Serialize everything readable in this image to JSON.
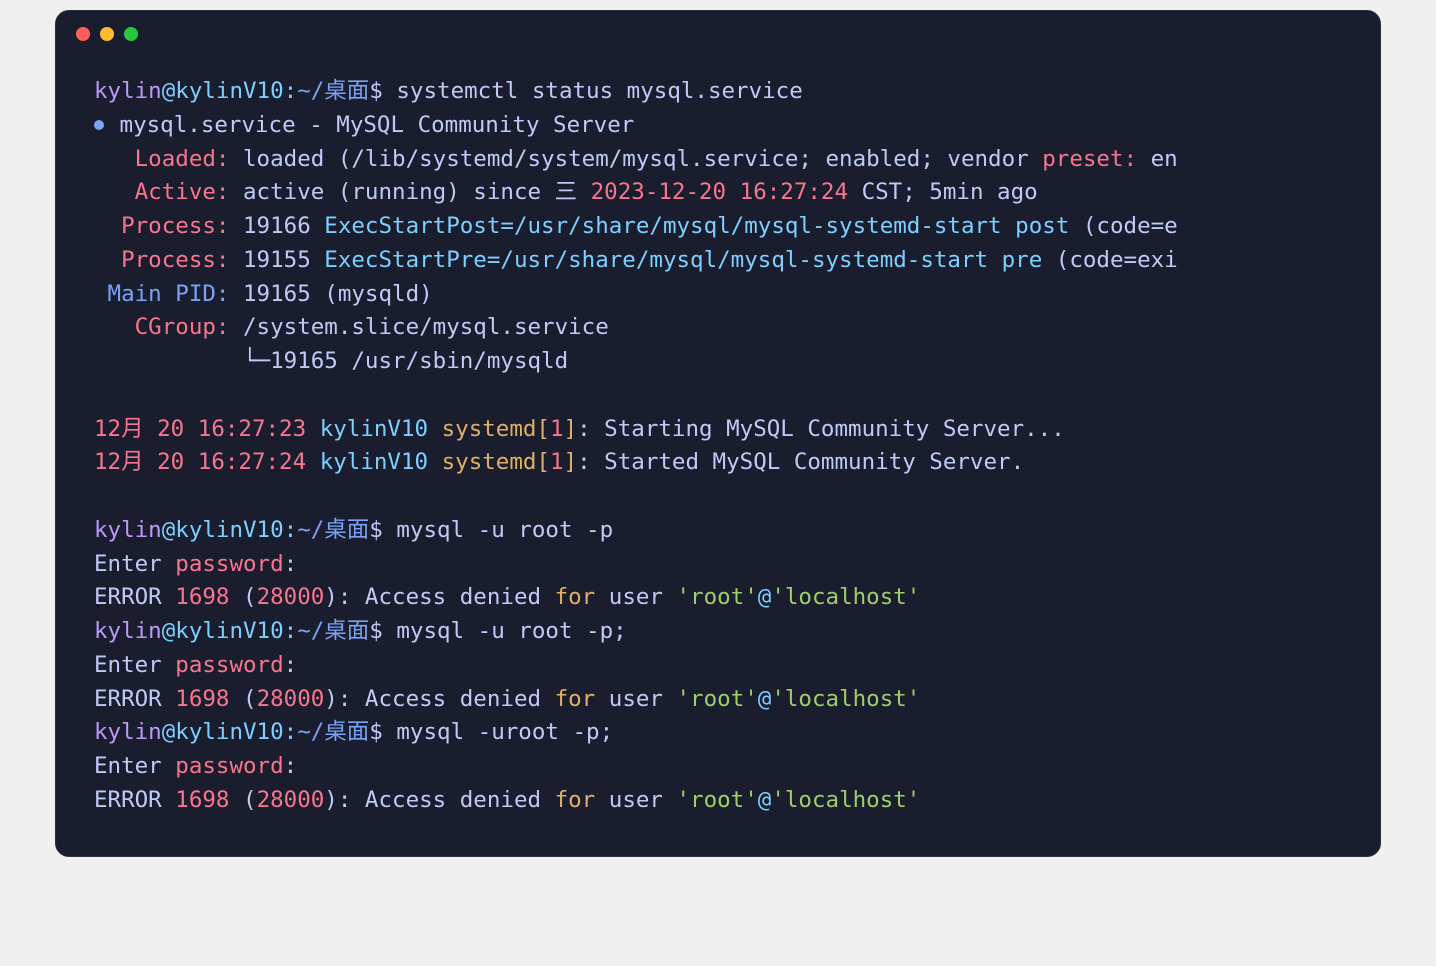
{
  "prompt": {
    "user": "kylin",
    "host": "kylinV10",
    "separator_at": "@",
    "colon": ":",
    "path": "~/桌面",
    "dollar": "$"
  },
  "commands": {
    "cmd1": "systemctl status mysql.service",
    "cmd2": "mysql -u root -p",
    "cmd3": "mysql -u root -p;",
    "cmd4": "mysql -uroot -p;"
  },
  "service": {
    "name": "mysql.service",
    "dash": " - ",
    "desc": "MySQL Community Server",
    "loaded_label": "Loaded:",
    "loaded_value": "loaded (/lib/systemd/system/mysql.service; enabled; vendor ",
    "preset_label": "preset:",
    "preset_value": " en",
    "active_label": "Active:",
    "active_value": "active (running)",
    "since": " since 三 ",
    "datetime": "2023-12-20 16:27:24",
    "tz_ago": " CST; 5min ago",
    "process1_label": "Process:",
    "process1_pid": "19166",
    "process1_cmd": "ExecStartPost=/usr/share/mysql/mysql-systemd-start post ",
    "process1_tail": "(code=e",
    "process2_label": "Process:",
    "process2_pid": "19155",
    "process2_cmd": "ExecStartPre=/usr/share/mysql/mysql-systemd-start pre ",
    "process2_tail": "(code=exi",
    "mainpid_label": "Main PID:",
    "mainpid_value": "19165 (mysqld)",
    "cgroup_label": "CGroup:",
    "cgroup_value": "/system.slice/mysql.service",
    "cgroup_tree": "└─19165 /usr/sbin/mysqld"
  },
  "logs": {
    "l1_time": "12月 20 16:27:23",
    "l1_host": " kylinV10 ",
    "l1_proc": "systemd[",
    "l1_num": "1",
    "l1_bracket": "]",
    "l1_msg": ": Starting MySQL Community Server...",
    "l2_time": "12月 20 16:27:24",
    "l2_host": " kylinV10 ",
    "l2_proc": "systemd[",
    "l2_num": "1",
    "l2_bracket": "]",
    "l2_msg": ": Started MySQL Community Server."
  },
  "mysql": {
    "enter": "Enter ",
    "password": "password",
    "colon": ":",
    "error": "ERROR ",
    "code": "1698 ",
    "paren_open": "(",
    "sqlstate": "28000",
    "paren_close": ")",
    "access_denied": ": Access denied ",
    "for": "for",
    "user_part": " user ",
    "root_str": "'root'",
    "at": "@",
    "localhost_str": "'localhost'"
  }
}
